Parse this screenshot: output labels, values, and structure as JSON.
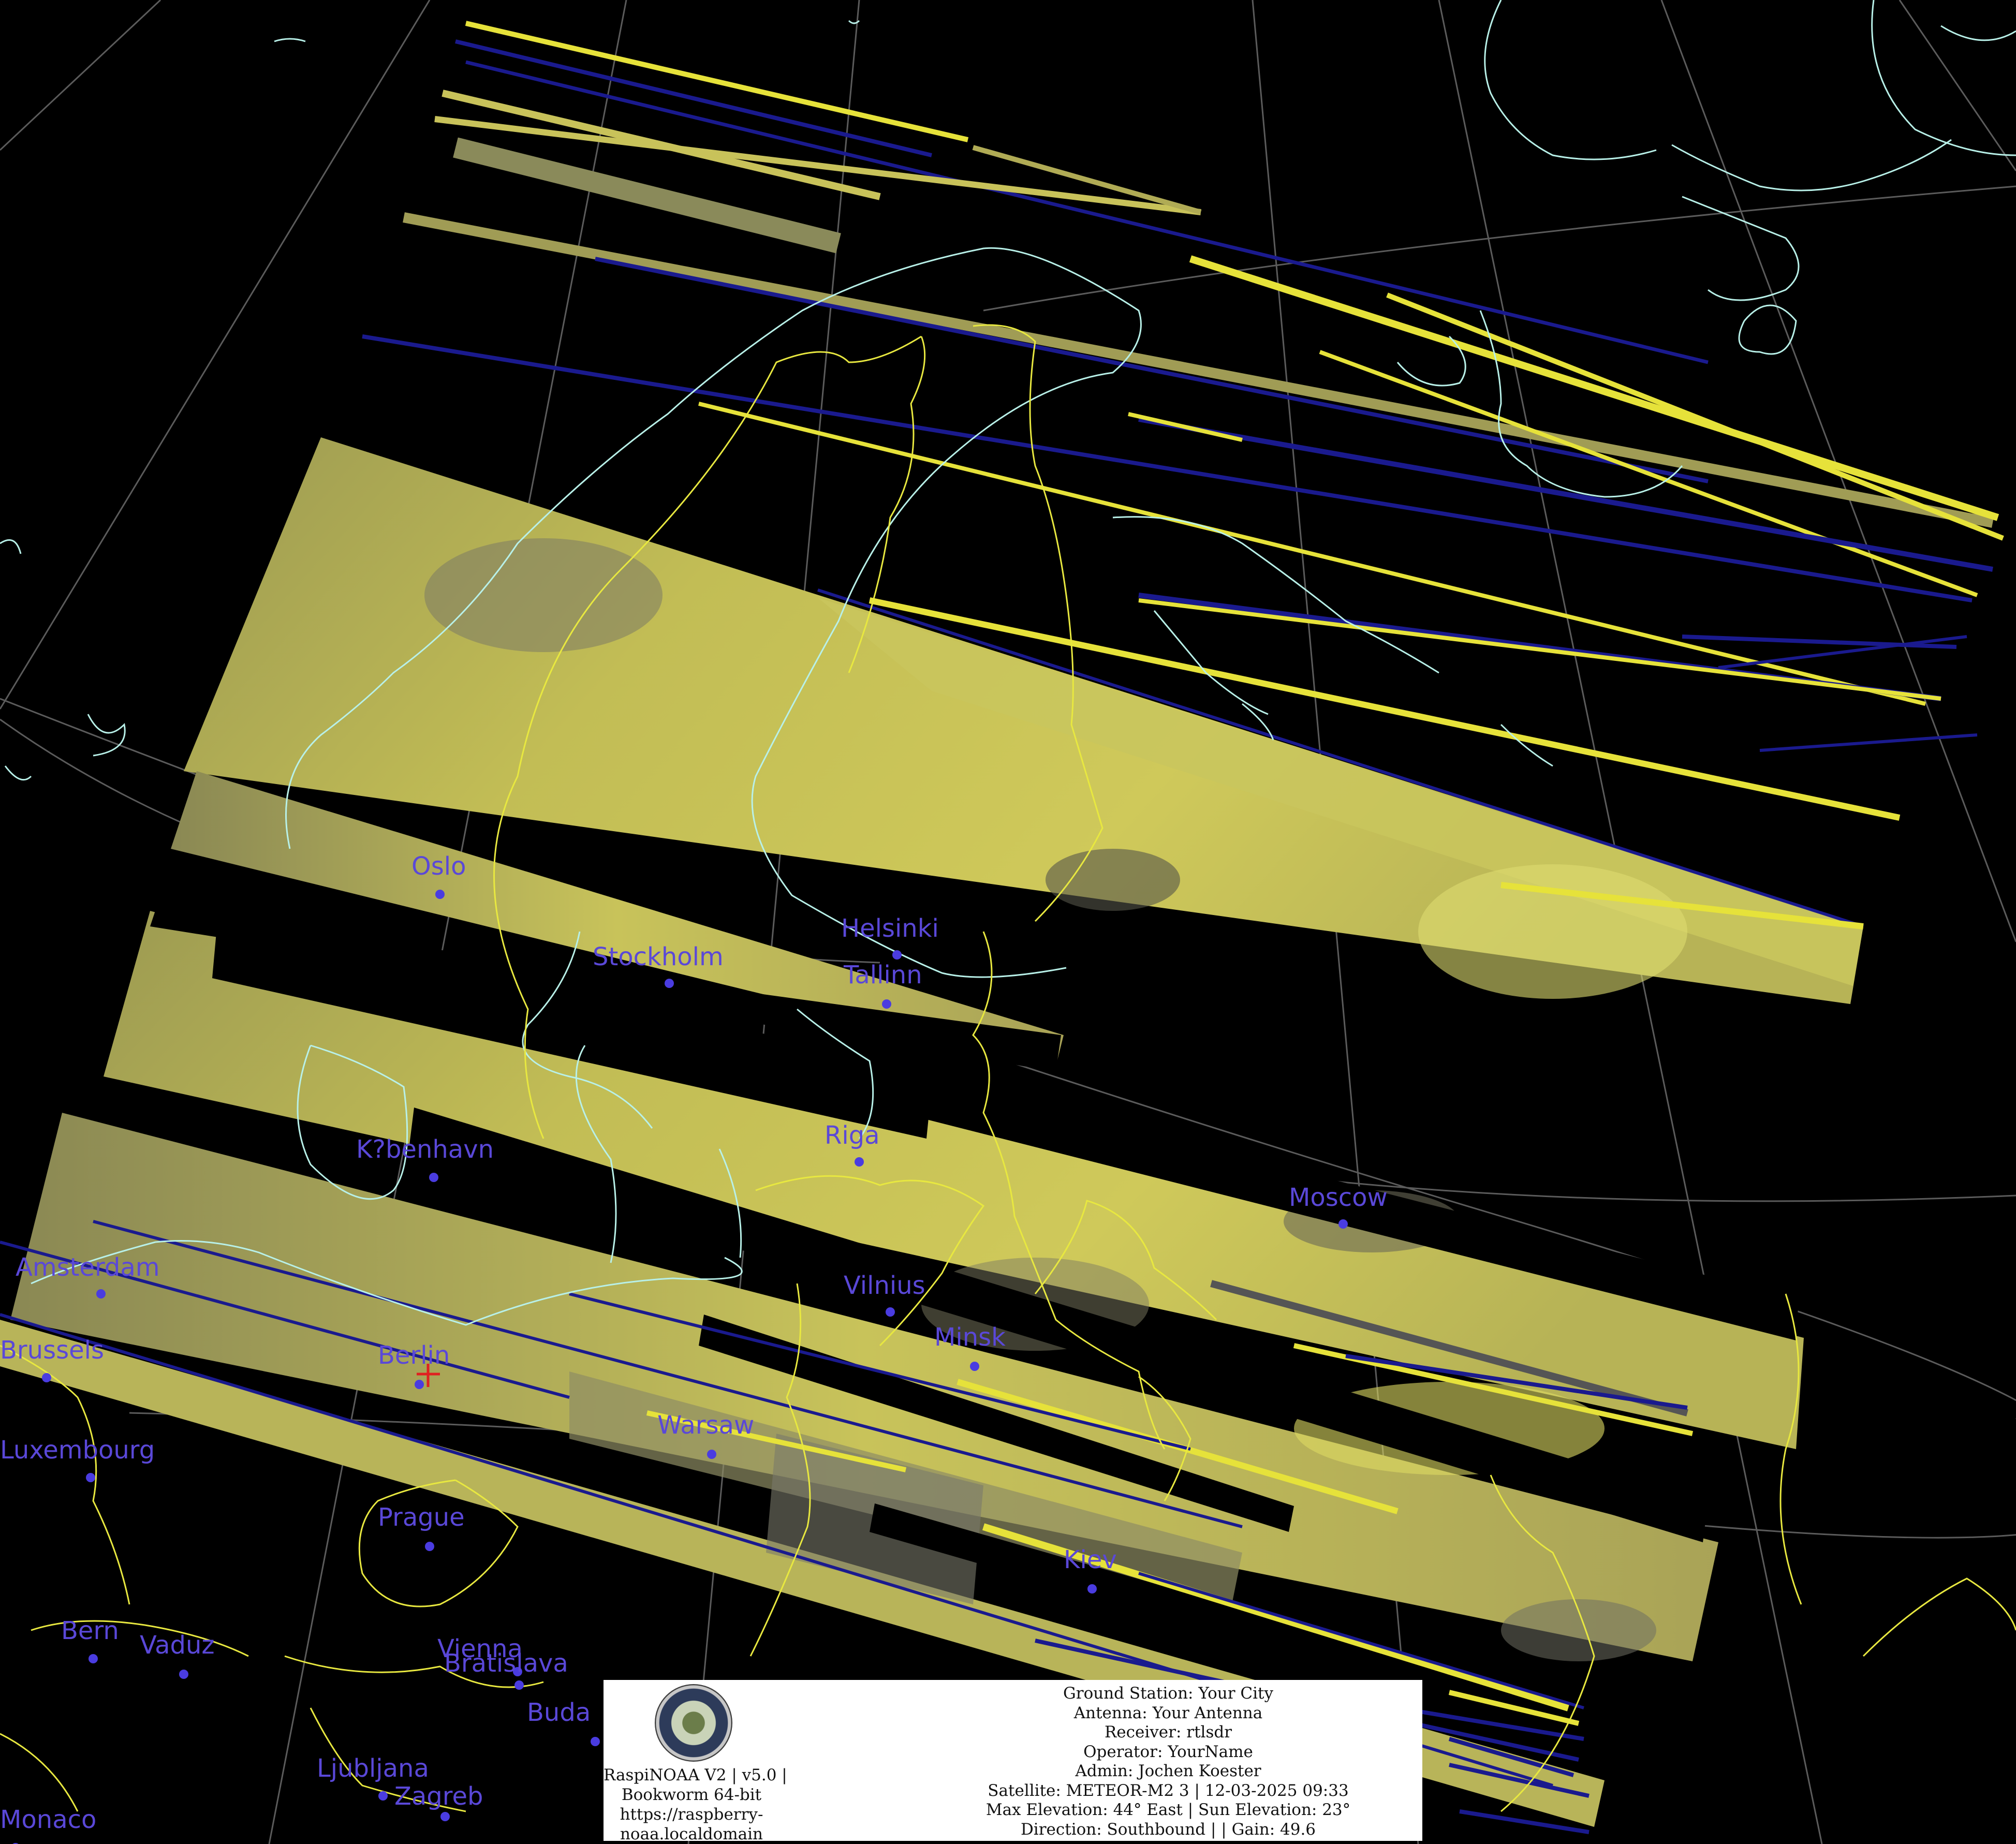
{
  "map": {
    "colors": {
      "background": "#000000",
      "imagery": "#c8c25a",
      "imagery_dark": "#6d6b4d",
      "scan_blue": "#1a1a8e",
      "scan_yellow": "#e6e23a",
      "coast": "#b8f0e8",
      "border": "#e8e840",
      "grid": "#8a8a8a",
      "city_label": "#5a48d8",
      "receiver_marker": "#e02020"
    },
    "cities": [
      {
        "id": "oslo",
        "label": "Oslo"
      },
      {
        "id": "stockholm",
        "label": "Stockholm"
      },
      {
        "id": "helsinki",
        "label": "Helsinki"
      },
      {
        "id": "tallinn",
        "label": "Tallinn"
      },
      {
        "id": "riga",
        "label": "Riga"
      },
      {
        "id": "kobenhavn",
        "label": "K?benhavn"
      },
      {
        "id": "moscow",
        "label": "Moscow"
      },
      {
        "id": "amsterdam",
        "label": "Amsterdam"
      },
      {
        "id": "vilnius",
        "label": "Vilnius"
      },
      {
        "id": "minsk",
        "label": "Minsk"
      },
      {
        "id": "brussels",
        "label": "Brussels"
      },
      {
        "id": "berlin",
        "label": "Berlin"
      },
      {
        "id": "warsaw",
        "label": "Warsaw"
      },
      {
        "id": "luxembourg",
        "label": "Luxembourg"
      },
      {
        "id": "prague",
        "label": "Prague"
      },
      {
        "id": "kiev",
        "label": "Kiev"
      },
      {
        "id": "bern",
        "label": "Bern"
      },
      {
        "id": "vaduz",
        "label": "Vaduz"
      },
      {
        "id": "vienna",
        "label": "Vienna"
      },
      {
        "id": "bratislava",
        "label": "Bratislava"
      },
      {
        "id": "budapest",
        "label": "Buda"
      },
      {
        "id": "ljubljana",
        "label": "Ljubljana"
      },
      {
        "id": "zagreb",
        "label": "Zagreb"
      },
      {
        "id": "monaco",
        "label": "Monaco"
      }
    ]
  },
  "info": {
    "left": {
      "line1": "RaspiNOAA V2 | v5.0 |",
      "line2": "Bookworm 64-bit",
      "line3": "https://raspberry-",
      "line4": "noaa.localdomain"
    },
    "right": {
      "ground_station": "Ground Station: Your City",
      "antenna": "Antenna: Your Antenna",
      "receiver": "Receiver: rtlsdr",
      "operator": "Operator: YourName",
      "admin": "Admin: Jochen Koester",
      "satellite": "Satellite: METEOR-M2 3 | 12-03-2025 09:33",
      "elevation": "Max Elevation: 44° East | Sun Elevation: 23°",
      "direction": "Direction: Southbound | | Gain: 49.6"
    }
  }
}
